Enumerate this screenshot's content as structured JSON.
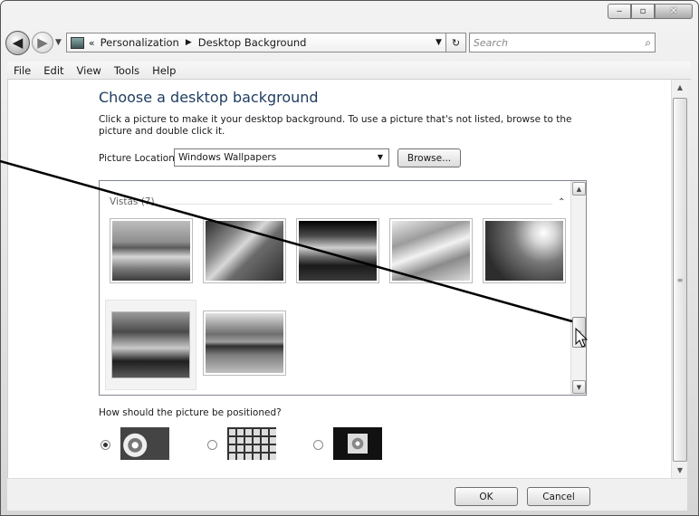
{
  "window": {
    "minimize_icon": "minimize-icon",
    "maximize_icon": "maximize-icon",
    "close_icon": "close-icon"
  },
  "nav": {
    "back_icon": "back-arrow-icon",
    "forward_icon": "forward-arrow-icon",
    "breadcrumb_prefix": "«",
    "breadcrumb": [
      "Personalization",
      "Desktop Background"
    ],
    "search_placeholder": "Search"
  },
  "menu": [
    "File",
    "Edit",
    "View",
    "Tools",
    "Help"
  ],
  "page": {
    "title": "Choose a desktop background",
    "description": "Click a picture to make it your desktop background. To use a picture that's not listed, browse to the picture and double click it.",
    "location_label": "Picture Location",
    "location_value": "Windows Wallpapers",
    "browse_label": "Browse...",
    "group_label": "Vistas (7)",
    "position_question": "How should the picture be positioned?"
  },
  "buttons": {
    "ok": "OK",
    "cancel": "Cancel"
  }
}
